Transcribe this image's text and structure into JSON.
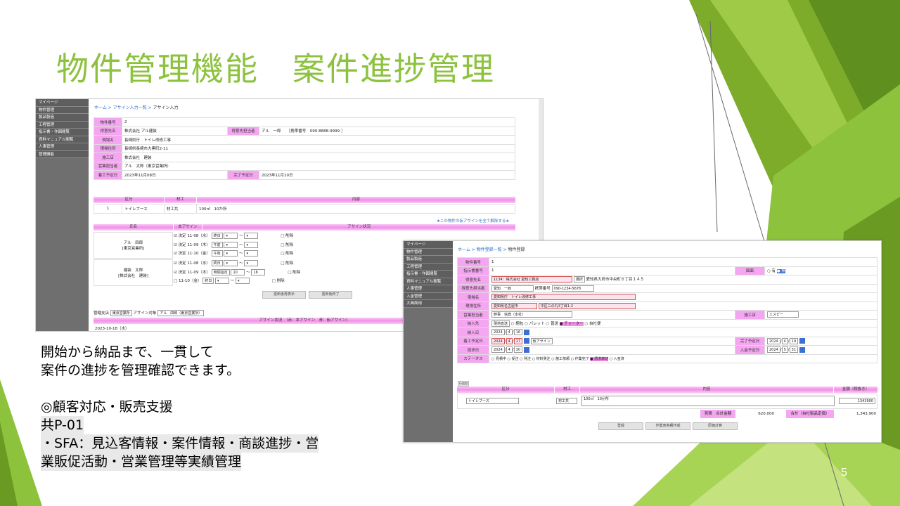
{
  "slide": {
    "title": "物件管理機能　案件進捗管理",
    "page_number": "5",
    "description": [
      "開始から納品まで、一貫して",
      "案件の進捗を管理確認できます。",
      "",
      "◎顧客対応・販売支援",
      "共P-01",
      "・SFA：見込客情報・案件情報・商談進捗・営",
      "業販促活動・営業管理等実績管理"
    ]
  },
  "win1": {
    "sidebar": [
      "マイページ",
      "物件管理",
      "製品製造",
      "工程管理",
      "指示書・作図閲覧",
      "資料マニュアル閲覧",
      "人事管理",
      "管理機能"
    ],
    "breadcrumb": {
      "home": "ホーム",
      "list": "アサイン入力一覧",
      "current": "アサイン入力"
    },
    "info": {
      "no_label": "物件番号",
      "no": "2",
      "client_label": "得意先名",
      "client": "株式会社 アル建装",
      "contact_label": "得意先担当者",
      "contact": "アル　一郎　　［携帯番号　090-8888-9999 ］",
      "site_label": "現場名",
      "site": "長崎県庁　トイレ改修工事",
      "addr_label": "現場住所",
      "addr": "長崎県長崎市大黒町2-11",
      "contractor_label": "施工店",
      "contractor": "株式会社　建装",
      "sales_label": "営業担当者",
      "sales": "アル　太郎（東京営業所）",
      "start_label": "着工予定日",
      "start": "2023年11月08日",
      "end_label": "完了予定日",
      "end": "2023年11月10日"
    },
    "items_header": {
      "kubun": "区分",
      "zaiko": "材工",
      "naiyo": "内容"
    },
    "items_row": {
      "idx": "1",
      "kubun": "トイレブース",
      "zaiko": "材工共",
      "naiyo": "100㎡　10か所"
    },
    "cancel_link": "★この物件の仮アサインを全て解除する★",
    "assign_header": {
      "name": "氏名",
      "main": "本アサイン",
      "status": "アサイン状況"
    },
    "people": [
      {
        "name": "アル　四郎",
        "org": "[東京営業所]",
        "rows": [
          {
            "chk": "☑ 決定",
            "date": "11-08（水）",
            "slot": "終日"
          },
          {
            "chk": "☑ 決定",
            "date": "11-09（木）",
            "slot": "午前"
          },
          {
            "chk": "☑ 決定",
            "date": "11-10（金）",
            "slot": "午後"
          }
        ]
      },
      {
        "name": "建装　太郎",
        "org": "[株式会社　建装]",
        "rows": [
          {
            "chk": "☑ 決定",
            "date": "11-08（水）",
            "slot": "終日"
          },
          {
            "chk": "☑ 決定",
            "date": "11-09（木）",
            "slot": "時間指定",
            "h1": "10",
            "h2": "16"
          },
          {
            "chk": "□",
            "date": "11-10（金）",
            "slot": "終日"
          }
        ]
      }
    ],
    "delete_label": "□ 削除",
    "tilde": "～",
    "btn_show": "更新後再表示",
    "btn_done": "更新後終了",
    "branch_label": "管轄支店",
    "branch": "東京営業所",
    "target_label": "アサイン対象",
    "target": "アル　四郎（東京営業所）",
    "status_bar": "アサイン状況　（赤：本アサイン　青：仮アサイン）",
    "date_row": "2023-10-18（水）"
  },
  "win2": {
    "sidebar": [
      "マイページ",
      "物件管理",
      "製品製造",
      "工程管理",
      "指示書・作図閲覧",
      "資料マニュアル閲覧",
      "人事管理",
      "入金管理",
      "大画面用"
    ],
    "breadcrumb": {
      "home": "ホーム",
      "list": "物件登録一覧",
      "current": "物件登録"
    },
    "fields": {
      "no_label": "物件番号",
      "no": "1",
      "order_label": "指示書番号",
      "order": "1",
      "drawing_label": "図面",
      "drawing_opts": [
        "○ 有",
        "● 無"
      ],
      "client_label": "得意先名",
      "client": "1134：株式会社 愛知工務店",
      "client_btn": "選択",
      "client_addr": "愛知県大府市中央町６丁目１４５",
      "contact_label": "得意先担当者",
      "contact": "愛知　一郎",
      "mobile_label": "携帯番号",
      "mobile": "090-1234-5678",
      "site_label": "現場名",
      "site": "愛知県庁　トイレ改修工事",
      "addr_label": "現場住所",
      "addr": "愛知県名古屋市",
      "addr2": "中区三の丸3丁目1-2",
      "sales_label": "営業担当者",
      "sales": "幹事　信典（本社）",
      "contractor_label": "施工店",
      "contractor": "エスピー",
      "delivery_label": "納入先",
      "delivery": "現地直送",
      "delivery_opts": [
        "○ 梱包",
        "○ パレット",
        "○ 普送",
        "● チャーター",
        "○ 自社便"
      ],
      "delivery_date_label": "納入日",
      "delivery_y": "2024",
      "delivery_m": "4",
      "delivery_d": "16",
      "start_label": "着工予定日",
      "start_y": "2024",
      "start_m": "4",
      "start_d": "17",
      "start_btn": "仮アサイン",
      "end_label": "完了予定日",
      "end_y": "2024",
      "end_m": "4",
      "end_d": "19",
      "bill_label": "請求日",
      "bill_y": "2024",
      "bill_m": "4",
      "bill_d": "30",
      "pay_label": "入金予定日",
      "pay_y": "2024",
      "pay_m": "5",
      "pay_d": "31",
      "status_label": "ステータス",
      "status_opts": [
        "○ 見積中",
        "○ 受注",
        "○ 発注",
        "○ 材料発注",
        "○ 施工依頼",
        "○ 作業完了",
        "● 請求締切",
        "○ 入金済"
      ]
    },
    "add_btn": "行追加",
    "items_header": {
      "kubun": "区分",
      "zaiko": "材工",
      "naiyo": "内容",
      "amount": "金額（税抜き）"
    },
    "item": {
      "kubun": "トイレブース",
      "zaiko": "材工共",
      "naiyo": "100㎡　10か所",
      "amount": "1343900"
    },
    "total_est_label": "見積　合計金額",
    "total_est": "620,000",
    "total_label": "合計（自社製品定価）",
    "total": "1,343,900",
    "btn_register": "登録",
    "btn_work": "作業表各種作成",
    "btn_cost": "原価計算"
  }
}
